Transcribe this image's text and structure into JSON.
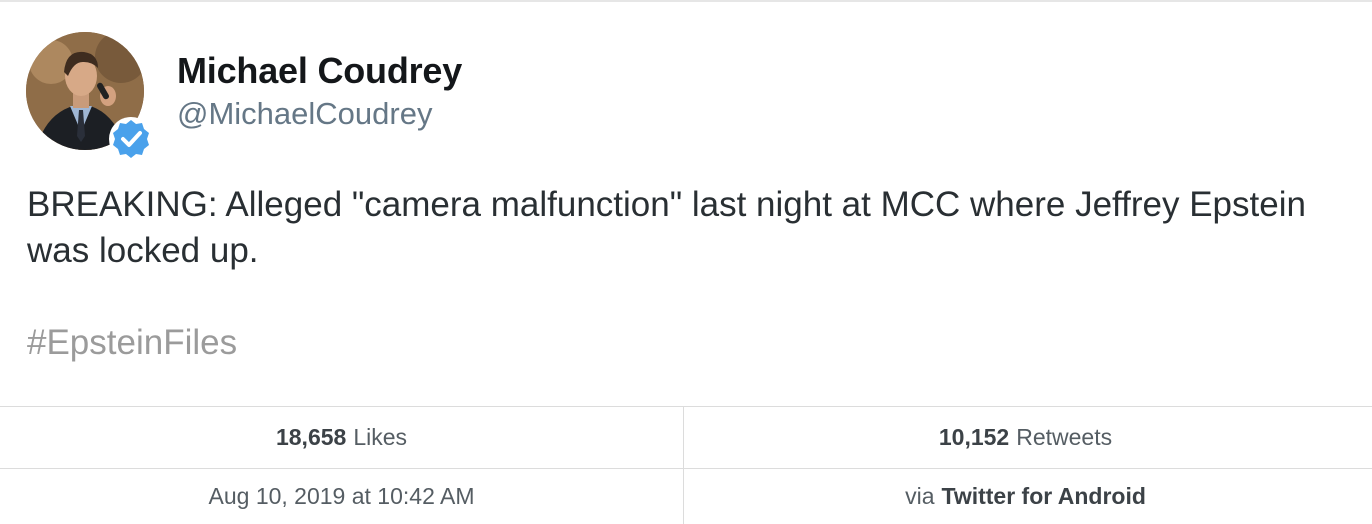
{
  "tweet": {
    "author": {
      "name": "Michael Coudrey",
      "handle": "@MichaelCoudrey",
      "verified": true,
      "avatar_icon": "profile-photo"
    },
    "text": "BREAKING: Alleged \"camera malfunction\" last night at MCC where Jeffrey Epstein was locked up.",
    "hashtag": "#EpsteinFiles",
    "stats": {
      "likes_count": "18,658",
      "likes_label": "Likes",
      "retweets_count": "10,152",
      "retweets_label": "Retweets"
    },
    "meta": {
      "timestamp": "Aug 10, 2019 at 10:42 AM",
      "via_label": "via",
      "source": "Twitter for Android"
    }
  },
  "colors": {
    "name": "#14171a",
    "handle": "#657786",
    "body": "#292f33",
    "hashtag": "#9b9b9b",
    "verified_blue": "#4aa1eb",
    "divider": "#dcdcdc"
  }
}
